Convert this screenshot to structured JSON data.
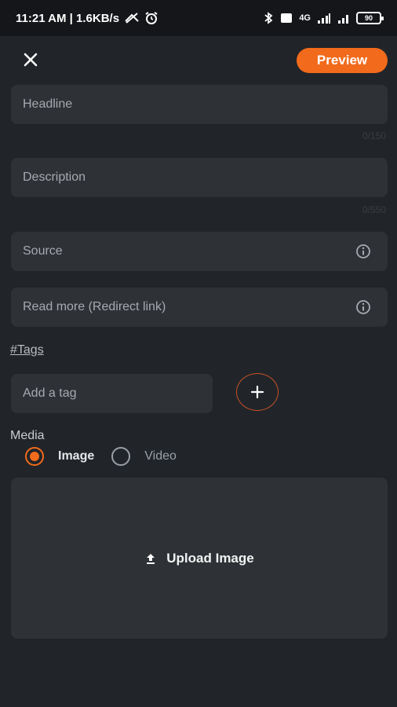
{
  "status_bar": {
    "time_speed": "11:21 AM | 1.6KB/s",
    "signal_text": "4G",
    "battery": "90"
  },
  "header": {
    "preview_label": "Preview"
  },
  "form": {
    "headline_placeholder": "Headline",
    "headline_counter": "0/150",
    "description_placeholder": "Description",
    "description_counter": "0/550",
    "source_placeholder": "Source",
    "readmore_placeholder": "Read more (Redirect link)",
    "tags_label": "#Tags",
    "tag_placeholder": "Add a tag",
    "media_label": "Media",
    "media_options": [
      "Image",
      "Video"
    ],
    "media_selected": "Image",
    "upload_label": "Upload Image"
  },
  "colors": {
    "accent": "#f26a1b",
    "background": "#212529",
    "field": "#2e3236"
  },
  "icons": {
    "close": "close-icon",
    "info": "info-icon",
    "add": "plus-icon",
    "upload": "upload-icon"
  }
}
